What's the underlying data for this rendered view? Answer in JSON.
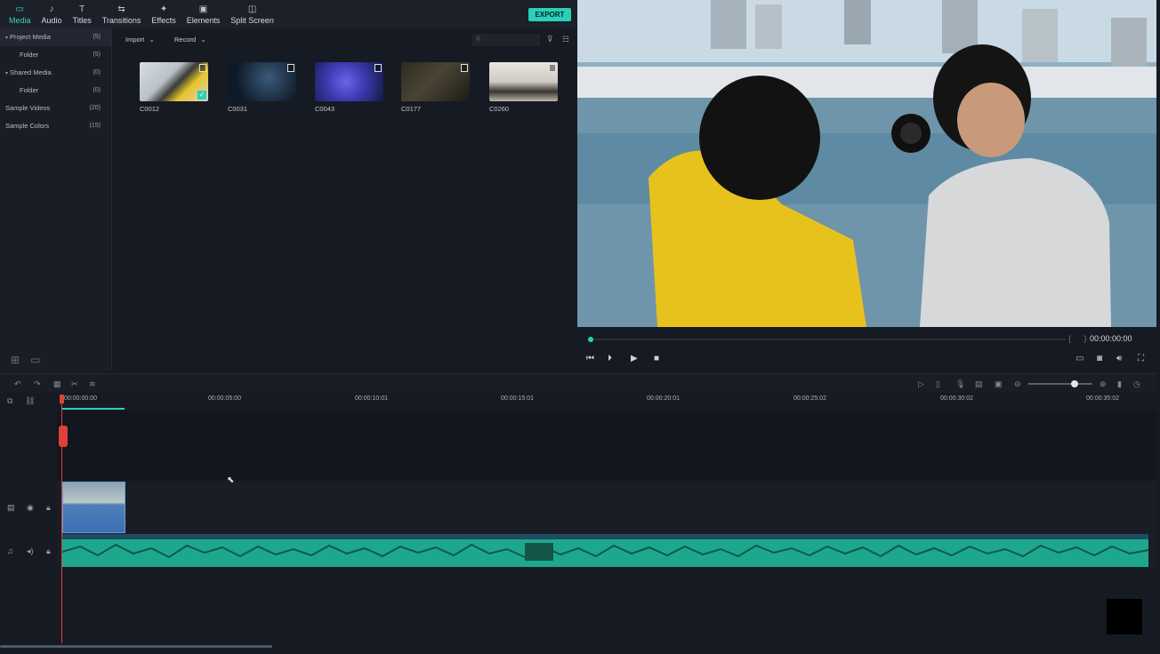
{
  "toolbar": {
    "tabs": [
      {
        "label": "Media",
        "icon": "folder-icon"
      },
      {
        "label": "Audio",
        "icon": "music-note-icon"
      },
      {
        "label": "Titles",
        "icon": "text-icon"
      },
      {
        "label": "Transitions",
        "icon": "transitions-icon"
      },
      {
        "label": "Effects",
        "icon": "effects-icon"
      },
      {
        "label": "Elements",
        "icon": "elements-icon"
      },
      {
        "label": "Split Screen",
        "icon": "split-screen-icon"
      }
    ],
    "export_label": "EXPORT",
    "accent": "#28d1b8"
  },
  "tree": {
    "items": [
      {
        "label": "Project Media",
        "count": "(5)"
      },
      {
        "label": "Folder",
        "count": "(5)"
      },
      {
        "label": "Shared Media",
        "count": "(0)"
      },
      {
        "label": "Folder",
        "count": "(0)"
      },
      {
        "label": "Sample Videos",
        "count": "(20)"
      },
      {
        "label": "Sample Colors",
        "count": "(15)"
      }
    ]
  },
  "media": {
    "import_label": "Import",
    "record_label": "Record",
    "search_placeholder": "",
    "clips": [
      {
        "label": "C0012"
      },
      {
        "label": "C0031"
      },
      {
        "label": "C0043"
      },
      {
        "label": "C0177"
      },
      {
        "label": "C0260"
      }
    ]
  },
  "player": {
    "timecode": "00:00:00:00",
    "progress": 0
  },
  "ruler": {
    "ticks": [
      "00:00:00:00",
      "00:00:05:00",
      "00:00:10:01",
      "00:00:15:01",
      "00:00:20:01",
      "00:00:25:02",
      "00:00:30:02",
      "00:00:35:02"
    ]
  },
  "timeline": {
    "zoom_level": 0.72
  }
}
